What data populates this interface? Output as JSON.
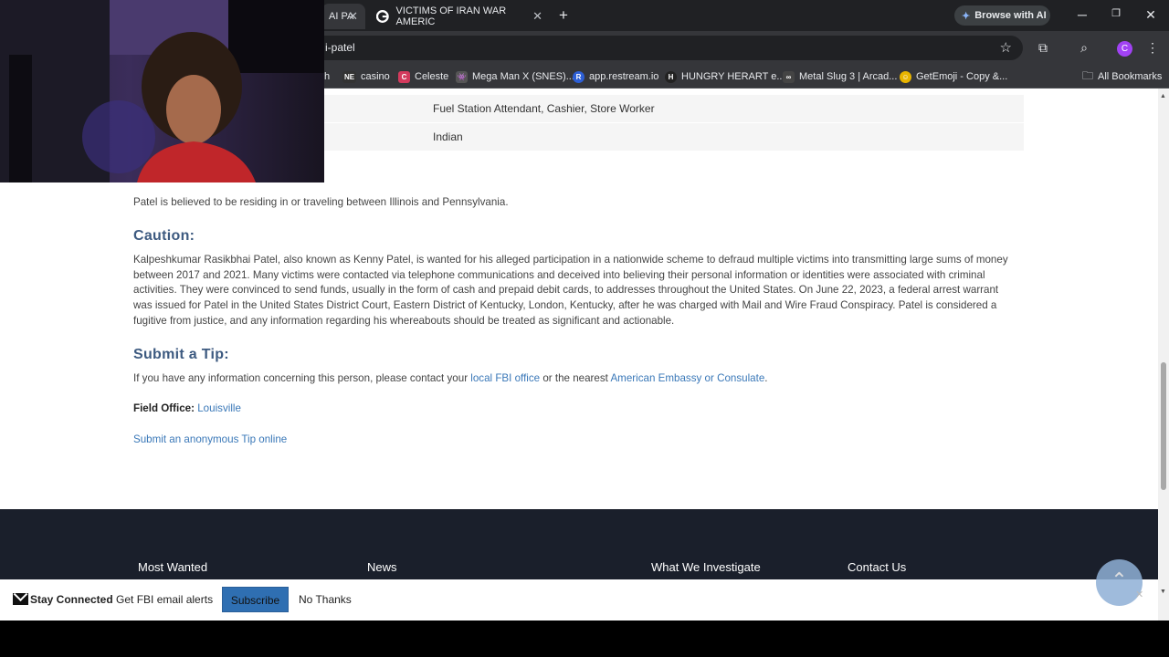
{
  "tabs": [
    {
      "label": "AI PA",
      "active": true
    },
    {
      "label": "VICTIMS OF IRAN WAR AMERIC"
    }
  ],
  "ai_button": "Browse with AI",
  "address": "i-patel",
  "profile_initial": "C",
  "bookmarks": [
    {
      "label": "h",
      "icon": ""
    },
    {
      "label": "casino",
      "icon": "NE"
    },
    {
      "label": "Celeste",
      "icon": "C"
    },
    {
      "label": "Mega Man X (SNES)...",
      "icon": "M"
    },
    {
      "label": "app.restream.io",
      "icon": "R"
    },
    {
      "label": "HUNGRY HERART e...",
      "icon": "H"
    },
    {
      "label": "Metal Slug 3 | Arcad...",
      "icon": "M"
    },
    {
      "label": "GetEmoji - Copy &...",
      "icon": "😋"
    },
    {
      "label": "All Bookmarks",
      "icon": "folder"
    }
  ],
  "details": {
    "occupation": "Fuel Station Attendant, Cashier, Store Worker",
    "nationality": "Indian"
  },
  "remarks": {
    "text": "Patel is believed to be residing in or traveling between Illinois and Pennsylvania."
  },
  "caution": {
    "heading": "Caution:",
    "line1": "Kalpeshkumar Rasikbhai Patel, also known as Kenny Patel, is wanted for his alleged participation in a nationwide scheme to defraud multiple victims into transmitting large sums of money",
    "line2": "between 2017 and 2021.  Many victims were contacted via telephone communications and deceived into believing their personal information or identities were associated with criminal",
    "line3": "activities.  They were convinced to send funds, usually in the form of cash and prepaid debit cards, to addresses throughout the United States.  On June 22, 2023, a federal arrest warrant",
    "line4": "was issued for Patel in the United States District Court, Eastern District of Kentucky, London, Kentucky, after he was charged with Mail and Wire Fraud Conspiracy.  Patel is considered a",
    "line5": "fugitive from justice, and any information regarding his whereabouts should be treated as significant and actionable."
  },
  "tip": {
    "heading": "Submit a Tip:",
    "text_before": "If you have any information concerning this person, please contact your ",
    "link1": "local FBI office",
    "text_mid": " or the nearest ",
    "link2": "American Embassy or Consulate",
    "text_end": ".",
    "field_office_label": "Field Office:",
    "field_office": "Louisville",
    "anon_link": "Submit an anonymous Tip online"
  },
  "footer": {
    "col1": "Most Wanted",
    "col2": "News",
    "col3": "What We Investigate",
    "col4": "Contact Us"
  },
  "stay_connected": {
    "title": "Stay Connected",
    "subtitle": "Get FBI email alerts",
    "subscribe": "Subscribe",
    "no_thanks": "No Thanks"
  }
}
